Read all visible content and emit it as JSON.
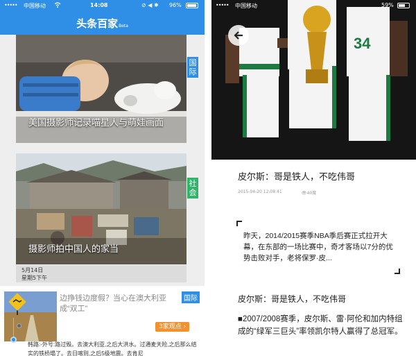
{
  "left_screen": {
    "status_bar": {
      "signal": "•••••",
      "carrier": "中国移动",
      "time": "14:08",
      "icons": "⊘ ◀ ✱",
      "battery": "96%"
    },
    "header": {
      "brand": "头条百家",
      "badge": "Beta"
    },
    "cards": [
      {
        "title": "美国摄影师记录喵星人与萌娃画面",
        "tag": "国际"
      },
      {
        "title": "摄影师拍中国人的家当",
        "tag": "社会"
      }
    ],
    "date": {
      "line1": "5月14日",
      "line2": "星期5下午"
    },
    "news": {
      "title": "边挣钱边度假？当心在澳大利亚成“双工”",
      "tag": "国际",
      "opinion": "3家观点 ›",
      "body": "韩路:-外号:路过毁。去澳大利亚,之后大洪水。过通麦天险,之后那么结实的铁桥塌了。去日喀则,之后5级地震。去肯尼"
    }
  },
  "right_screen": {
    "status_bar": {
      "signal": "•••••",
      "carrier": "中国移动",
      "battery": "59%"
    },
    "article": {
      "title": "皮尔斯：哥是铁人，不吃伟哥",
      "date": "2015-04-20 12:08:41",
      "views": "40度",
      "quote": "昨天，2014/2015赛季NBA季后赛正式拉开大幕，在东部的一场比赛中，奇才客场以7分的优势击败对手，老将保罗·皮...",
      "subtitle": "皮尔斯：哥是铁人，不吃伟哥",
      "paragraph": "■2007/2008赛季，皮尔斯、雷·阿伦和加内特组成的“绿军三巨头”率领凯尔特人赢得了总冠军。"
    }
  },
  "colors": {
    "brand_blue": "#2f8ee6",
    "social_green": "#2fb56a",
    "opinion_orange": "#f39130"
  }
}
